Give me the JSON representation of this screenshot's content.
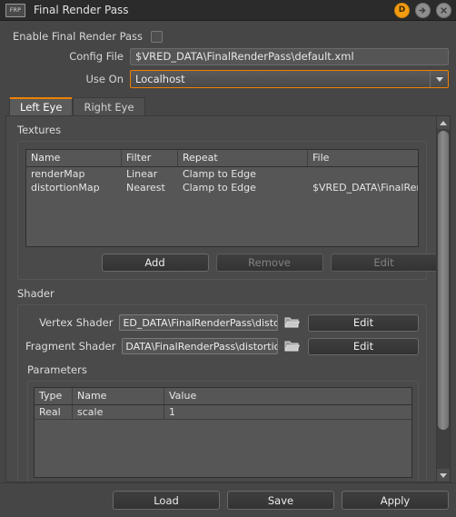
{
  "window": {
    "app_badge": "FRP",
    "title": "Final Render Pass",
    "buttons": {
      "docking": "D",
      "detach": "detach-arrow-icon",
      "close": "close-icon"
    }
  },
  "enable": {
    "label": "Enable Final Render Pass",
    "checked": false
  },
  "fields": {
    "config_file_label": "Config File",
    "config_file_value": "$VRED_DATA\\FinalRenderPass\\default.xml",
    "use_on_label": "Use On",
    "use_on_value": "Localhost"
  },
  "tabs": [
    {
      "label": "Left Eye",
      "active": true
    },
    {
      "label": "Right Eye",
      "active": false
    }
  ],
  "textures": {
    "group_title": "Textures",
    "columns": [
      "Name",
      "Filter",
      "Repeat",
      "File"
    ],
    "rows": [
      [
        "renderMap",
        "Linear",
        "Clamp to Edge",
        ""
      ],
      [
        "distortionMap",
        "Nearest",
        "Clamp to Edge",
        "$VRED_DATA\\FinalRenderPass\\..."
      ]
    ],
    "buttons": [
      {
        "label": "Add",
        "enabled": true
      },
      {
        "label": "Remove",
        "enabled": false
      },
      {
        "label": "Edit",
        "enabled": false
      }
    ]
  },
  "shader": {
    "group_title": "Shader",
    "vertex_label": "Vertex Shader",
    "vertex_value": "ED_DATA\\FinalRenderPass\\distortion.vp",
    "vertex_edit": "Edit",
    "fragment_label": "Fragment Shader",
    "fragment_value": "DATA\\FinalRenderPass\\distortion-left.fp",
    "fragment_edit": "Edit",
    "browse_icon": "folder-open-icon"
  },
  "parameters": {
    "group_title": "Parameters",
    "columns": [
      "Type",
      "Name",
      "Value"
    ],
    "rows": [
      [
        "Real",
        "scale",
        "1"
      ]
    ]
  },
  "footer": {
    "load": "Load",
    "save": "Save",
    "apply": "Apply"
  },
  "colors": {
    "accent": "#f08000",
    "window_bg": "#464646",
    "titlebar_bg": "#2b2b2b",
    "field_bg": "#555555",
    "text": "#d4d4d4"
  }
}
